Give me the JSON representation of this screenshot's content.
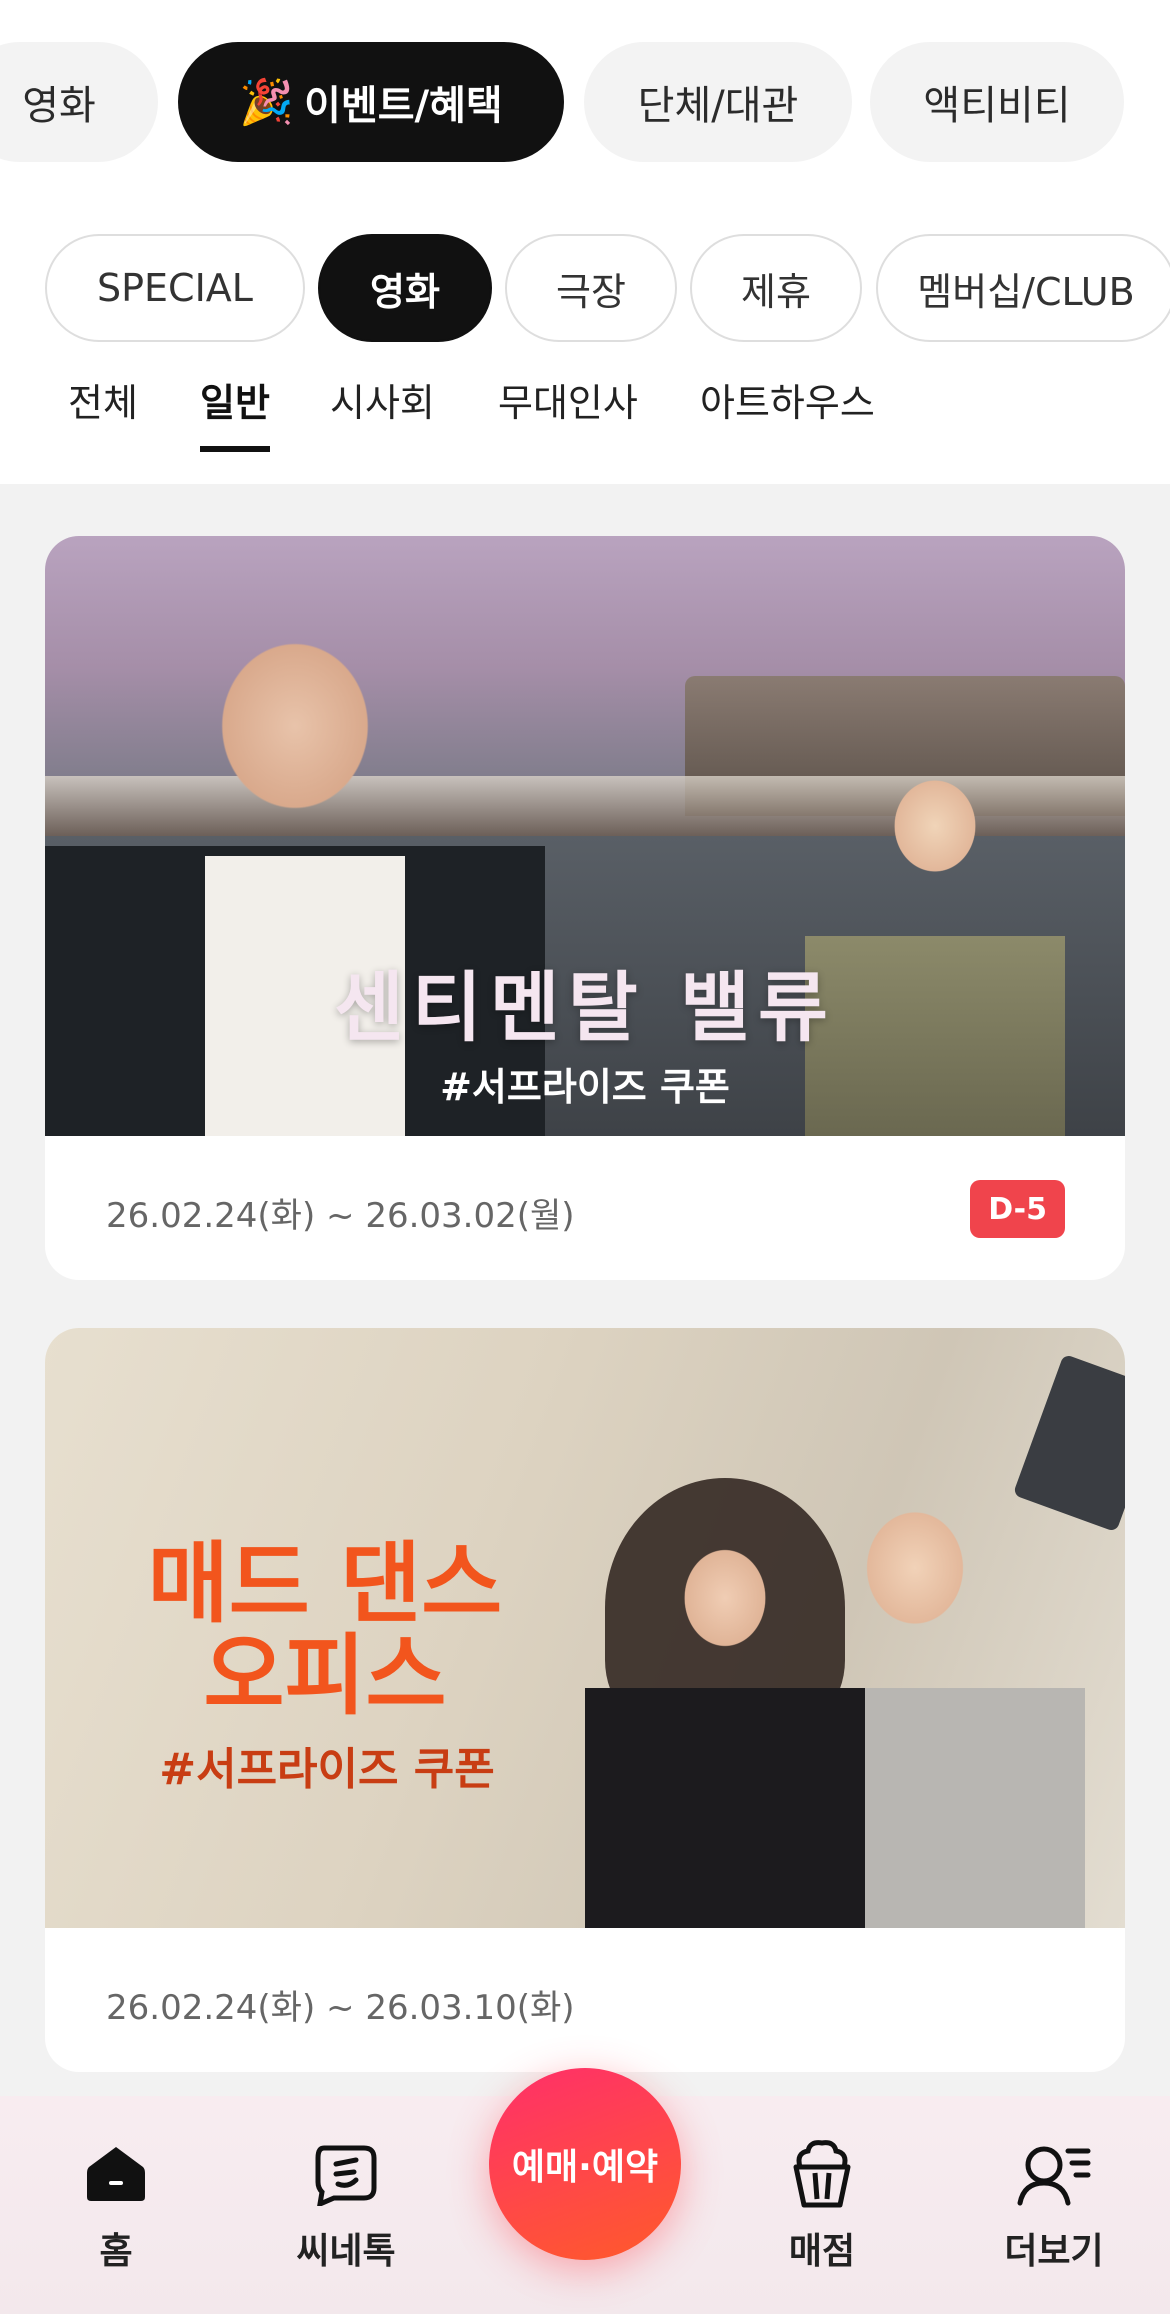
{
  "categories": [
    {
      "label": "영화",
      "active": false
    },
    {
      "label": "이벤트/혜택",
      "active": true,
      "icon": "party-popper-icon"
    },
    {
      "label": "단체/대관",
      "active": false
    },
    {
      "label": "액티비티",
      "active": false
    }
  ],
  "subcategories": [
    {
      "label": "SPECIAL",
      "active": false
    },
    {
      "label": "영화",
      "active": true
    },
    {
      "label": "극장",
      "active": false
    },
    {
      "label": "제휴",
      "active": false
    },
    {
      "label": "멤버십/CLUB",
      "active": false
    }
  ],
  "tabs": [
    {
      "label": "전체",
      "active": false
    },
    {
      "label": "일반",
      "active": true
    },
    {
      "label": "시사회",
      "active": false
    },
    {
      "label": "무대인사",
      "active": false
    },
    {
      "label": "아트하우스",
      "active": false
    }
  ],
  "events": [
    {
      "poster_title": "센티멘탈 밸류",
      "poster_tag": "#서프라이즈 쿠폰",
      "dates": "26.02.24(화) ~ 26.03.02(월)",
      "badge": "D-5"
    },
    {
      "poster_title": "매드 댄스 오피스",
      "poster_tag": "#서프라이즈 쿠폰",
      "dates": "26.02.24(화) ~ 26.03.10(화)",
      "badge": ""
    }
  ],
  "bottom_nav": {
    "items": [
      {
        "label": "홈",
        "icon": "home-icon"
      },
      {
        "label": "씨네톡",
        "icon": "chat-icon"
      },
      {
        "label": "매점",
        "icon": "popcorn-icon"
      },
      {
        "label": "더보기",
        "icon": "more-user-icon"
      }
    ],
    "book_label": "예매·예약"
  },
  "colors": {
    "accent_red": "#f0444c",
    "book_button": "#ff3f55",
    "active_pill": "#111111"
  }
}
